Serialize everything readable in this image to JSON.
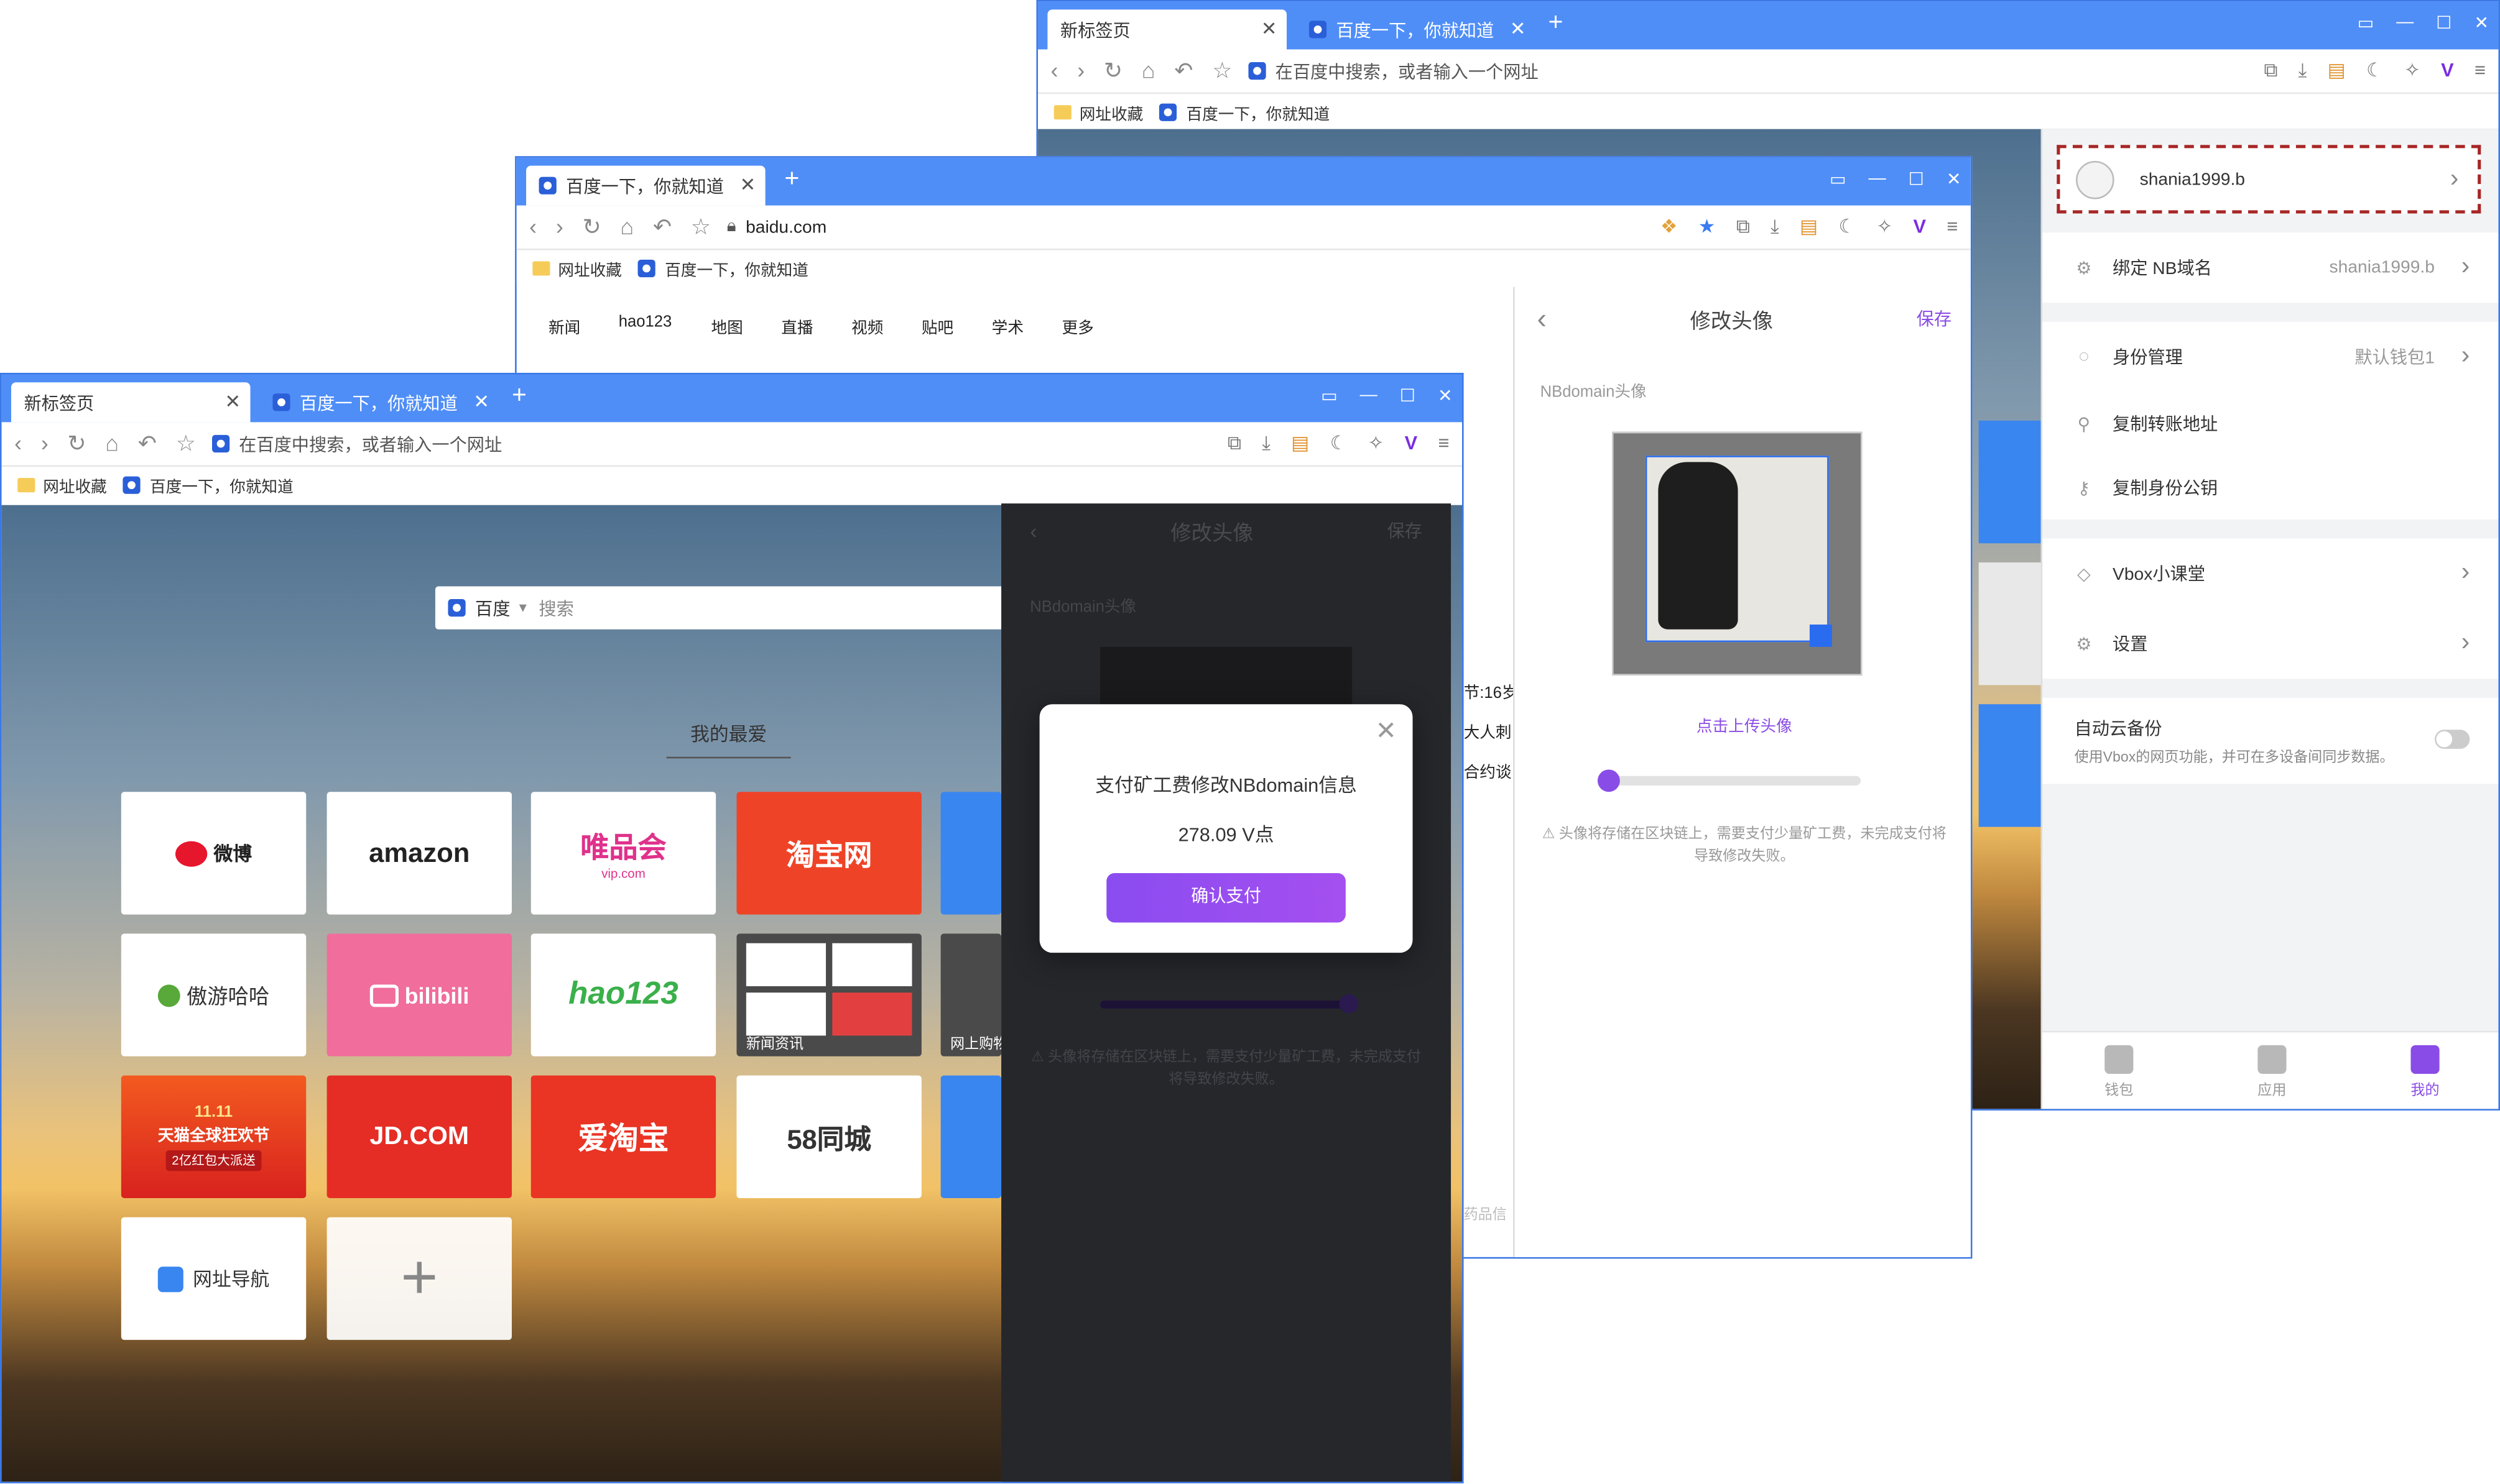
{
  "colors": {
    "tab_blue": "#4f8ef7",
    "accent_purple": "#8a4ce6",
    "dashed_red": "#a82626"
  },
  "win_back": {
    "tabs": [
      "新标签页",
      "百度一下，你就知道"
    ],
    "address_placeholder": "在百度中搜索，或者输入一个网址",
    "bookmarks": [
      "网址收藏",
      "百度一下，你就知道"
    ],
    "account": {
      "name": "shania1999.b"
    },
    "menu": [
      {
        "label": "绑定 NB域名",
        "value": "shania1999.b",
        "icon": "gear-icon"
      },
      {
        "label": "身份管理",
        "value": "默认钱包1",
        "icon": "person-icon"
      },
      {
        "label": "复制转账地址",
        "value": "",
        "icon": "link-icon"
      },
      {
        "label": "复制身份公钥",
        "value": "",
        "icon": "key-icon"
      },
      {
        "label": "Vbox小课堂",
        "value": "",
        "icon": "layers-icon"
      },
      {
        "label": "设置",
        "value": "",
        "icon": "settings-icon"
      }
    ],
    "auto_backup": {
      "title": "自动云备份",
      "desc": "使用Vbox的网页功能，并可在多设备间同步数据。"
    },
    "bottom_nav": [
      "钱包",
      "应用",
      "我的"
    ]
  },
  "win_mid": {
    "tab": "百度一下，你就知道",
    "address": "baidu.com",
    "bookmarks": [
      "网址收藏",
      "百度一下，你就知道"
    ],
    "baidu_nav": [
      "新闻",
      "hao123",
      "地图",
      "直播",
      "视频",
      "贴吧",
      "学术",
      "更多"
    ],
    "partial_text": [
      "节:16岁",
      "大人刺",
      "合约谈",
      "药品信"
    ],
    "avatar_panel": {
      "title": "修改头像",
      "save": "保存",
      "section": "NBdomain头像",
      "upload": "点击上传头像",
      "slider_value": 0,
      "note": "⚠ 头像将存储在区块链上，需要支付少量矿工费，未完成支付将导致修改失败。"
    }
  },
  "win_front": {
    "tabs": [
      "新标签页",
      "百度一下，你就知道"
    ],
    "address_placeholder": "在百度中搜索，或者输入一个网址",
    "bookmarks": [
      "网址收藏",
      "百度一下，你就知道"
    ],
    "search_engine": "百度",
    "search_placeholder": "搜索",
    "favorites_title": "我的最爱",
    "tiles": [
      "微博",
      "amazon",
      "唯品会",
      "淘宝网",
      "新闻资讯",
      "傲游哈哈",
      "bilibili",
      "hao123",
      "网上购物",
      "天猫全球狂欢节",
      "JD.COM",
      "爱淘宝",
      "58同城",
      "网址导航"
    ],
    "tile_sub": {
      "vip": "vip.com",
      "tmall": "2亿红包大派送",
      "tmall_date": "11.11"
    },
    "dim_panel": {
      "title": "修改头像",
      "save": "保存",
      "section": "NBdomain头像",
      "note": "⚠ 头像将存储在区块链上，需要支付少量矿工费，未完成支付将导致修改失败。"
    },
    "modal": {
      "title": "支付矿工费修改NBdomain信息",
      "amount": "278.09 V点",
      "confirm": "确认支付"
    }
  }
}
